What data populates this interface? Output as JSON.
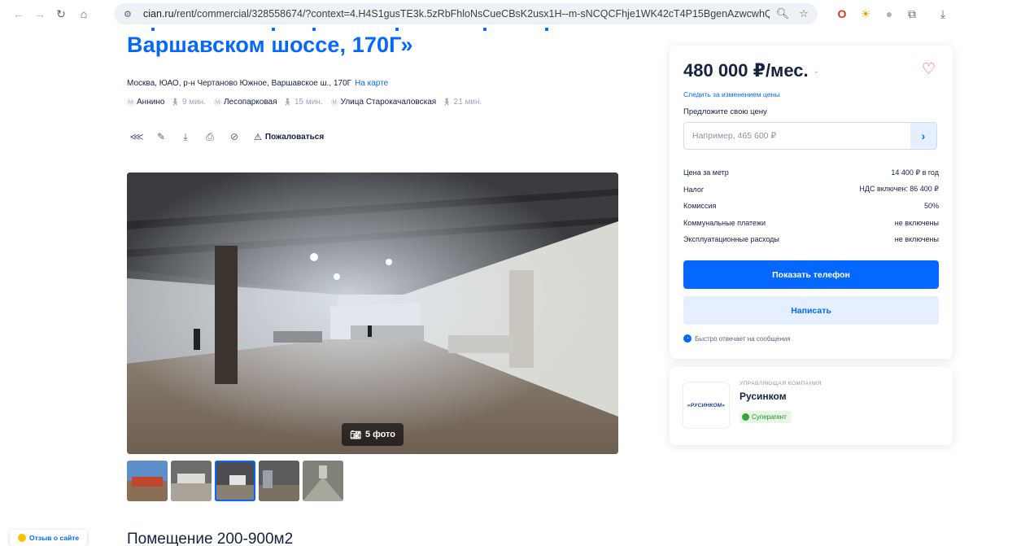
{
  "browser": {
    "url_host": "cian.ru",
    "url_rest": "/rent/commercial/328558674/?context=4.H4S1gusTE3k.5zRbFhloNsCueCBsK2usx1H--m-sNCQCFhje1WK42cT4P15BgenAzwcwhQ5qcsFexCdcrjDmQl..."
  },
  "listing": {
    "title": "Варшавском шоссе, 170Г»",
    "address": "Москва, ЮАО, р-н Чертаново Южное, Варшавское ш., 170Г",
    "map_link": "На карте",
    "metro": [
      {
        "name": "Аннино",
        "time": "9 мин."
      },
      {
        "name": "Лесопарковая",
        "time": "15 мин."
      },
      {
        "name": "Улица Старокачаловская",
        "time": "21 мин."
      }
    ],
    "complain": "Пожаловаться",
    "photo_count": "5 фото",
    "section_title": "Помещение 200-900м2"
  },
  "price_card": {
    "price": "480 000 ₽/мес.",
    "follow_link": "Следить за изменением цены",
    "offer_label": "Предложите свою цену",
    "offer_placeholder": "Например, 465 600 ₽",
    "specs": [
      {
        "label": "Цена за метр",
        "value": "14 400 ₽ в год"
      },
      {
        "label": "Налог",
        "value": "НДС включен: 86 400 ₽"
      },
      {
        "label": "Комиссия",
        "value": "50%"
      },
      {
        "label": "Коммунальные платежи",
        "value": "не включены"
      },
      {
        "label": "Эксплуатационные расходы",
        "value": "не включены"
      }
    ],
    "show_phone": "Показать телефон",
    "write": "Написать",
    "quick_reply": "Быстро отвечает на сообщения"
  },
  "agent": {
    "type": "Управляющая компания",
    "name": "Русинком",
    "logo_text": "«РУСИНКОМ»",
    "badge": "Суперагент"
  },
  "feedback": "Отзыв о сайте",
  "colors": {
    "accent": "#0468ff",
    "heart": "#e8514d",
    "badge_green": "#34a53e"
  }
}
